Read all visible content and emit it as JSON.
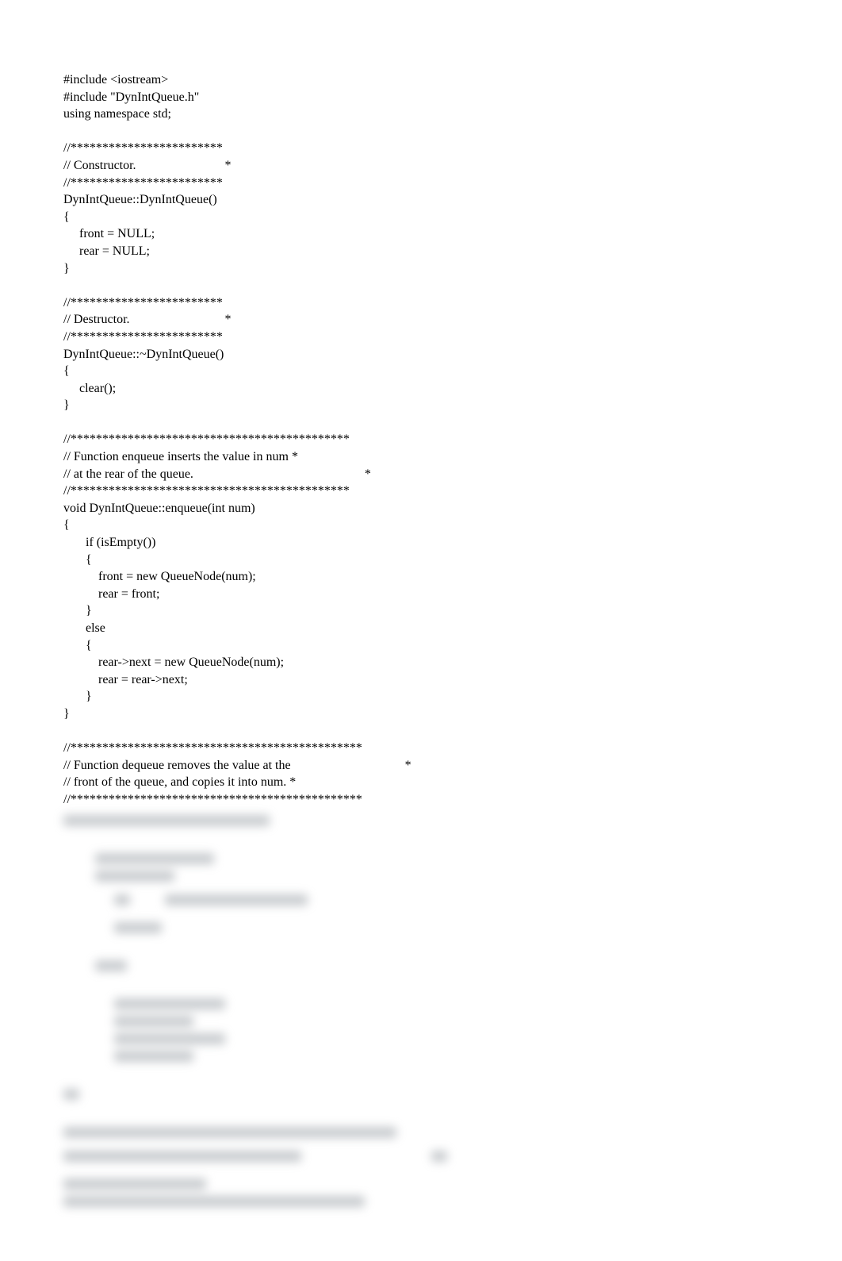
{
  "code": {
    "l1": "#include <iostream>",
    "l2": "#include \"DynIntQueue.h\"",
    "l3": "using namespace std;",
    "l4": "",
    "l5": "//************************",
    "l6": "// Constructor.                            *",
    "l7": "//************************",
    "l8": "DynIntQueue::DynIntQueue()",
    "l9": "{",
    "l10": "     front = NULL;",
    "l11": "     rear = NULL;",
    "l12": "}",
    "l13": "",
    "l14": "//************************",
    "l15": "// Destructor.                              *",
    "l16": "//************************",
    "l17": "DynIntQueue::~DynIntQueue()",
    "l18": "{",
    "l19": "     clear();",
    "l20": "}",
    "l21": "",
    "l22": "//********************************************",
    "l23": "// Function enqueue inserts the value in num *",
    "l24": "// at the rear of the queue.                                                      *",
    "l25": "//********************************************",
    "l26": "void DynIntQueue::enqueue(int num)",
    "l27": "{",
    "l28": "       if (isEmpty())",
    "l29": "       {",
    "l30": "           front = new QueueNode(num);",
    "l31": "           rear = front;",
    "l32": "       }",
    "l33": "       else",
    "l34": "       {",
    "l35": "           rear->next = new QueueNode(num);",
    "l36": "           rear = rear->next;",
    "l37": "       }",
    "l38": "}",
    "l39": "",
    "l40": "//**********************************************",
    "l41": "// Function dequeue removes the value at the                                    *",
    "l42": "// front of the queue, and copies it into num. *",
    "l43": "//**********************************************"
  }
}
